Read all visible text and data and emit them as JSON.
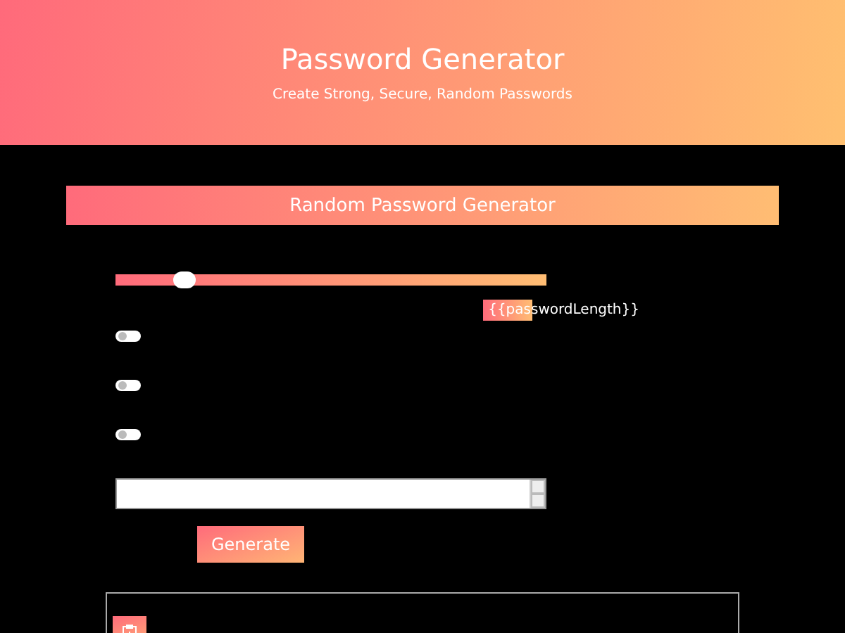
{
  "header": {
    "title": "Password Generator",
    "subtitle": "Create Strong, Secure, Random Passwords"
  },
  "card": {
    "title": "Random Password Generator"
  },
  "length_slider": {
    "level": 0.16,
    "reading": "{{passwordLength}}"
  },
  "toggles": [
    {
      "on": false
    },
    {
      "on": false
    },
    {
      "on": false
    }
  ],
  "generate_button": "Generate"
}
